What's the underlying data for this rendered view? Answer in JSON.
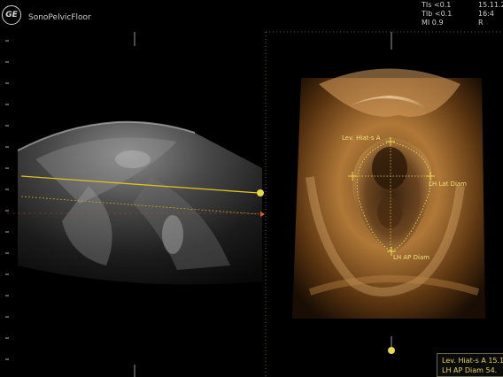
{
  "header": {
    "logo_text": "GE",
    "app_name": "SonoPelvicFloor",
    "readouts": [
      "TIs <0.1",
      "TIb <0.1",
      "MI  0.9"
    ],
    "date_col": [
      "15.11.2",
      "16:4",
      "R"
    ]
  },
  "volume_labels": {
    "hiatus_area": "Lev. Hiat-s A",
    "lat_diam": "LH Lat Diam",
    "ap_diam": "LH AP Diam"
  },
  "marker_icons": [
    "caliper-cross-icon",
    "plane-marker-icon"
  ],
  "measurements": {
    "line1": "Lev. Hiat-s A 15.1",
    "line2": "LH AP Diam   54."
  },
  "colors": {
    "caliper": "#e8d84a",
    "reference_line": "#e0c020",
    "sepia_highlight": "#e8b878"
  }
}
